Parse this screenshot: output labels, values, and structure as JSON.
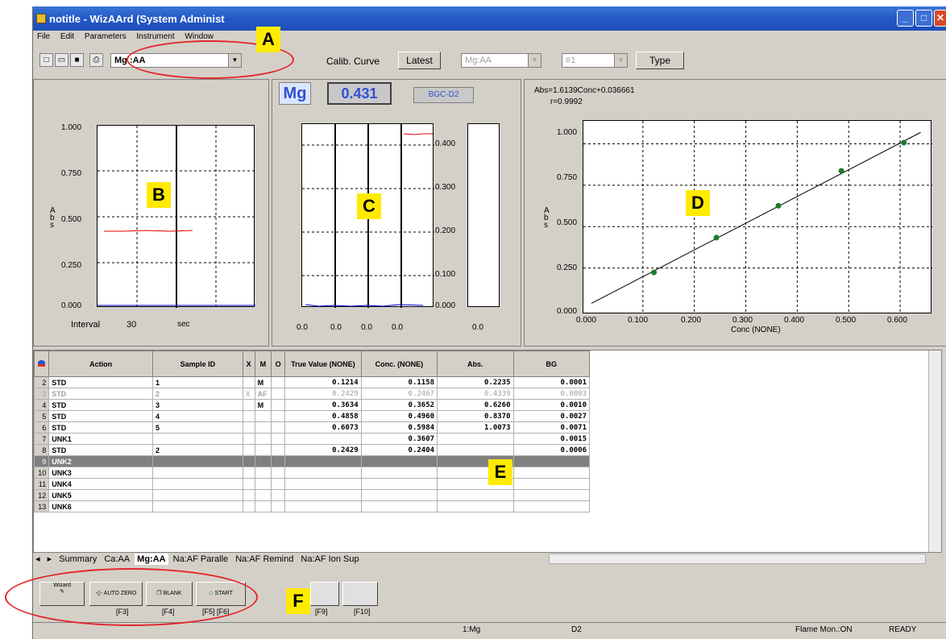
{
  "window": {
    "title": "notitle - WizAArd (System Administ"
  },
  "menu": [
    "File",
    "Edit",
    "Parameters",
    "Instrument",
    "Window"
  ],
  "toolbar": {
    "element_combo": "Mg :AA",
    "calib_curve_label": "Calib. Curve",
    "latest_button": "Latest",
    "calib_combo1": "Mg:AA",
    "calib_combo2": "#1",
    "type_button": "Type"
  },
  "graph_b": {
    "yticks": [
      "1.000",
      "0.750",
      "0.500",
      "0.250",
      "0.000"
    ],
    "ylabel": "A\nb\ns",
    "interval_label": "Interval",
    "interval_value": "30",
    "unit": "sec"
  },
  "graph_c": {
    "element": "Mg",
    "value": "0.431",
    "bgc": "BGC-D2",
    "yticks": [
      "0.400",
      "0.300",
      "0.200",
      "0.100",
      "0.000"
    ],
    "xticks": [
      "0.0",
      "0.0",
      "0.0",
      "0.0",
      "0.0"
    ]
  },
  "graph_d": {
    "equation": "Abs=1.6139Conc+0.036661",
    "r": "r=0.9992",
    "ylabel": "A\nb\ns",
    "yticks": [
      "1.000",
      "0.750",
      "0.500",
      "0.250",
      "0.000"
    ],
    "xticks": [
      "0.000",
      "0.100",
      "0.200",
      "0.300",
      "0.400",
      "0.500",
      "0.600"
    ],
    "xlabel": "Conc (NONE)"
  },
  "chart_data": {
    "type": "scatter",
    "x": [
      0.1214,
      0.2429,
      0.3634,
      0.4858,
      0.6073
    ],
    "y": [
      0.2235,
      0.4339,
      0.626,
      0.837,
      1.0073
    ],
    "xlim": [
      0,
      0.65
    ],
    "ylim": [
      0,
      1.1
    ],
    "fit": {
      "slope": 1.6139,
      "intercept": 0.036661
    },
    "xlabel": "Conc (NONE)",
    "ylabel": "Abs"
  },
  "table": {
    "headers": [
      "Action",
      "Sample ID",
      "X",
      "M",
      "O",
      "True Value (NONE)",
      "Conc. (NONE)",
      "Abs.",
      "BG"
    ],
    "rows": [
      {
        "n": "2",
        "action": "STD",
        "id": "1",
        "x": "",
        "m": "M",
        "o": "",
        "tv": "0.1214",
        "conc": "0.1158",
        "abs": "0.2235",
        "bg": "0.0001",
        "style": ""
      },
      {
        "n": "3",
        "action": "STD",
        "id": "2",
        "x": "X",
        "m": "AF",
        "o": "",
        "tv": "0.2429",
        "conc": "0.2467",
        "abs": "0.4339",
        "bg": "0.0003",
        "style": "faded"
      },
      {
        "n": "4",
        "action": "STD",
        "id": "3",
        "x": "",
        "m": "M",
        "o": "",
        "tv": "0.3634",
        "conc": "0.3652",
        "abs": "0.6260",
        "bg": "0.0010",
        "style": ""
      },
      {
        "n": "5",
        "action": "STD",
        "id": "4",
        "x": "",
        "m": "",
        "o": "",
        "tv": "0.4858",
        "conc": "0.4960",
        "abs": "0.8370",
        "bg": "0.0027",
        "style": ""
      },
      {
        "n": "6",
        "action": "STD",
        "id": "5",
        "x": "",
        "m": "",
        "o": "",
        "tv": "0.6073",
        "conc": "0.5984",
        "abs": "1.0073",
        "bg": "0.0071",
        "style": ""
      },
      {
        "n": "7",
        "action": "UNK1",
        "id": "",
        "x": "",
        "m": "",
        "o": "",
        "tv": "",
        "conc": "0.3607",
        "abs": "",
        "bg": "0.0015",
        "style": ""
      },
      {
        "n": "8",
        "action": "STD",
        "id": "2",
        "x": "",
        "m": "",
        "o": "",
        "tv": "0.2429",
        "conc": "0.2404",
        "abs": "",
        "bg": "0.0006",
        "style": ""
      },
      {
        "n": "9",
        "action": "UNK2",
        "id": "",
        "x": "",
        "m": "",
        "o": "",
        "tv": "",
        "conc": "",
        "abs": "",
        "bg": "",
        "style": "sel"
      },
      {
        "n": "10",
        "action": "UNK3",
        "id": "",
        "x": "",
        "m": "",
        "o": "",
        "tv": "",
        "conc": "",
        "abs": "",
        "bg": "",
        "style": ""
      },
      {
        "n": "11",
        "action": "UNK4",
        "id": "",
        "x": "",
        "m": "",
        "o": "",
        "tv": "",
        "conc": "",
        "abs": "",
        "bg": "",
        "style": ""
      },
      {
        "n": "12",
        "action": "UNK5",
        "id": "",
        "x": "",
        "m": "",
        "o": "",
        "tv": "",
        "conc": "",
        "abs": "",
        "bg": "",
        "style": ""
      },
      {
        "n": "13",
        "action": "UNK6",
        "id": "",
        "x": "",
        "m": "",
        "o": "",
        "tv": "",
        "conc": "",
        "abs": "",
        "bg": "",
        "style": ""
      }
    ]
  },
  "tabs": [
    "Summary",
    "Ca:AA",
    "Mg:AA",
    "Na:AF Paralle",
    "Na:AF Remind",
    "Na:AF Ion Sup"
  ],
  "bottom_buttons": [
    {
      "label": "Wizard",
      "key": ""
    },
    {
      "label": "AUTO ZERO",
      "key": "[F3]"
    },
    {
      "label": "BLANK",
      "key": "[F4]"
    },
    {
      "label": "START",
      "key": "[F5] [F6]"
    }
  ],
  "bottom_buttons2": [
    {
      "label": "",
      "key": "[F9]"
    },
    {
      "label": "",
      "key": "[F10]"
    }
  ],
  "status": {
    "element": "1:Mg",
    "bgc": "D2",
    "flame": "Flame Mon.:ON",
    "ready": "READY"
  },
  "annotations": [
    "A",
    "B",
    "C",
    "D",
    "E",
    "F"
  ]
}
